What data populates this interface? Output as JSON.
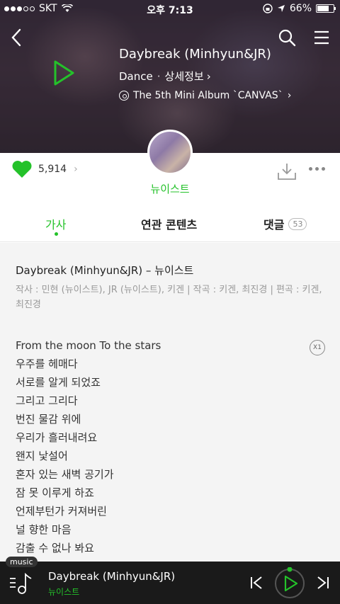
{
  "status_bar": {
    "carrier": "SKT",
    "time": "오후 7:13",
    "battery": "66%"
  },
  "song": {
    "title": "Daybreak (Minhyun&JR)",
    "genre": "Dance",
    "detail_link": "상세정보",
    "album": "The 5th Mini Album `CANVAS`"
  },
  "artist": {
    "name": "뉴이스트"
  },
  "stats": {
    "likes": "5,914"
  },
  "tabs": {
    "lyrics": "가사",
    "related": "연관 콘텐츠",
    "comments": "댓글",
    "comment_count": "53"
  },
  "lyrics": {
    "heading": "Daybreak (Minhyun&JR) – 뉴이스트",
    "credits": "작사 : 민현 (뉴이스트), JR (뉴이스트), 키겐 | 작곡 : 키겐, 최진경 | 편곡 : 키겐, 최진경",
    "speed_label": "X1",
    "lines": [
      "From the moon To the stars",
      "우주를 헤매다",
      "서로를 알게 되었죠",
      "그리고 그리다",
      "번진 물감 위에",
      "우리가 흘러내려요",
      "왠지 낯설어",
      "혼자 있는 새벽 공기가",
      "잠 못 이루게 하죠",
      "언제부턴가 커져버린",
      "널 향한 마음",
      "감출 수 없나 봐요"
    ]
  },
  "player": {
    "tag": "music",
    "title": "Daybreak (Minhyun&JR)",
    "artist": "뉴이스트"
  },
  "colors": {
    "accent": "#24c22a",
    "player_bg": "#1a1a1a",
    "lyrics_bg": "#f4f4f4"
  }
}
